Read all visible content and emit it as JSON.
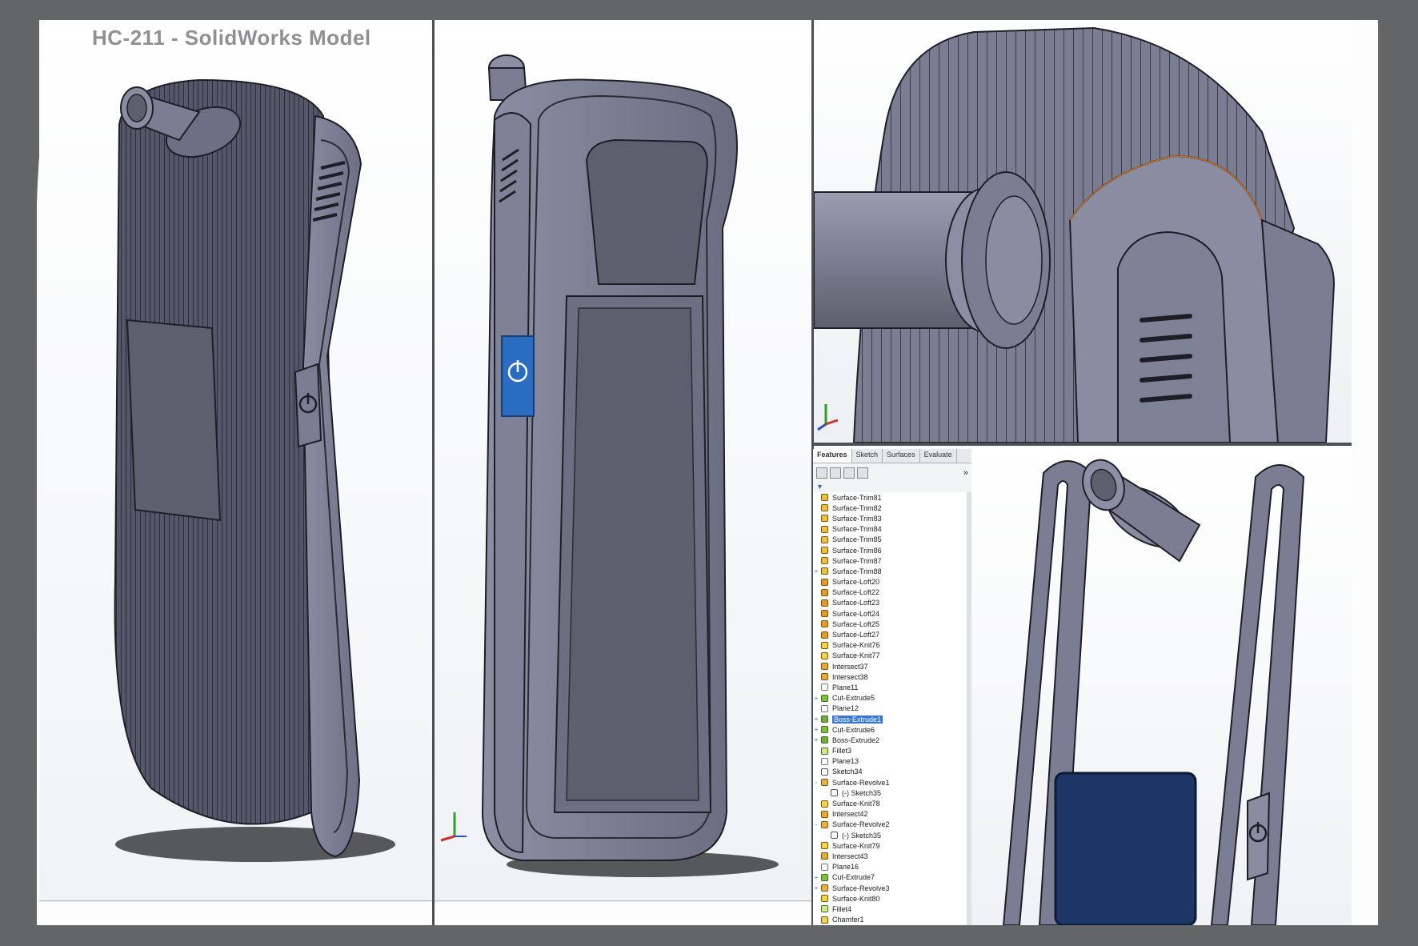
{
  "title": "HC-211 - SolidWorks  Model",
  "feature_manager": {
    "tabs": [
      "Features",
      "Sketch",
      "Surfaces",
      "Evaluate"
    ],
    "active_tab": "Features",
    "items": [
      {
        "label": "Surface-Trim81",
        "kind": "trim",
        "expand": ""
      },
      {
        "label": "Surface-Trim82",
        "kind": "trim",
        "expand": ""
      },
      {
        "label": "Surface-Trim83",
        "kind": "trim",
        "expand": ""
      },
      {
        "label": "Surface-Trim84",
        "kind": "trim",
        "expand": ""
      },
      {
        "label": "Surface-Trim85",
        "kind": "trim",
        "expand": ""
      },
      {
        "label": "Surface-Trim86",
        "kind": "trim",
        "expand": ""
      },
      {
        "label": "Surface-Trim87",
        "kind": "trim",
        "expand": ""
      },
      {
        "label": "Surface-Trim88",
        "kind": "trim",
        "expand": "+"
      },
      {
        "label": "Surface-Loft20",
        "kind": "loft",
        "expand": ""
      },
      {
        "label": "Surface-Loft22",
        "kind": "loft",
        "expand": ""
      },
      {
        "label": "Surface-Loft23",
        "kind": "loft",
        "expand": ""
      },
      {
        "label": "Surface-Loft24",
        "kind": "loft",
        "expand": ""
      },
      {
        "label": "Surface-Loft25",
        "kind": "loft",
        "expand": ""
      },
      {
        "label": "Surface-Loft27",
        "kind": "loft",
        "expand": ""
      },
      {
        "label": "Surface-Knit76",
        "kind": "knit",
        "expand": ""
      },
      {
        "label": "Surface-Knit77",
        "kind": "knit",
        "expand": ""
      },
      {
        "label": "Intersect37",
        "kind": "intersect",
        "expand": ""
      },
      {
        "label": "Intersect38",
        "kind": "intersect",
        "expand": ""
      },
      {
        "label": "Plane11",
        "kind": "plane",
        "expand": ""
      },
      {
        "label": "Cut-Extrude5",
        "kind": "cut",
        "expand": "+"
      },
      {
        "label": "Plane12",
        "kind": "plane",
        "expand": ""
      },
      {
        "label": "Boss-Extrude1",
        "kind": "boss",
        "expand": "+",
        "selected": true
      },
      {
        "label": "Cut-Extrude6",
        "kind": "cut",
        "expand": "+"
      },
      {
        "label": "Boss-Extrude2",
        "kind": "boss",
        "expand": "+"
      },
      {
        "label": "Fillet3",
        "kind": "fillet",
        "expand": ""
      },
      {
        "label": "Plane13",
        "kind": "plane",
        "expand": ""
      },
      {
        "label": "Sketch34",
        "kind": "sketch",
        "expand": ""
      },
      {
        "label": "Surface-Revolve1",
        "kind": "revolve",
        "expand": "-"
      },
      {
        "label": "(-) Sketch35",
        "kind": "sketch",
        "expand": "",
        "child": true
      },
      {
        "label": "Surface-Knit78",
        "kind": "knit",
        "expand": ""
      },
      {
        "label": "Intersect42",
        "kind": "intersect",
        "expand": ""
      },
      {
        "label": "Surface-Revolve2",
        "kind": "revolve",
        "expand": "-"
      },
      {
        "label": "(-) Sketch35",
        "kind": "sketch",
        "expand": "",
        "child": true
      },
      {
        "label": "Surface-Knit79",
        "kind": "knit",
        "expand": ""
      },
      {
        "label": "Intersect43",
        "kind": "intersect",
        "expand": ""
      },
      {
        "label": "Plane16",
        "kind": "plane",
        "expand": ""
      },
      {
        "label": "Cut-Extrude7",
        "kind": "cut",
        "expand": "+"
      },
      {
        "label": "Surface-Revolve3",
        "kind": "revolve",
        "expand": "+"
      },
      {
        "label": "Surface-Knit80",
        "kind": "knit",
        "expand": ""
      },
      {
        "label": "Fillet4",
        "kind": "fillet",
        "expand": ""
      },
      {
        "label": "Chamfer1",
        "kind": "chamfer",
        "expand": ""
      }
    ]
  },
  "colors": {
    "background": "#646566",
    "model_body": "#7b7e92",
    "model_dark": "#3e3f4a",
    "screen": "#5d5f6c",
    "power_button_selected": "#2a6cc0",
    "display_panel": "#1e3567",
    "selection": "#3875d7"
  }
}
